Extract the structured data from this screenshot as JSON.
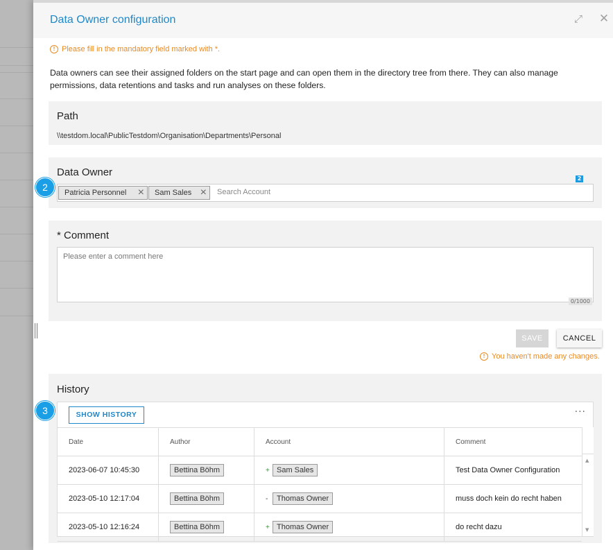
{
  "panel": {
    "title": "Data Owner configuration",
    "mandatory_notice": "Please fill in the mandatory field marked with *.",
    "intro": "Data owners can see their assigned folders on the start page and can open them in the directory tree from there. They can also manage permissions, data retentions and tasks and run analyses on these folders."
  },
  "path": {
    "label": "Path",
    "value": "\\\\testdom.local\\PublicTestdom\\Organisation\\Departments\\Personal"
  },
  "data_owner": {
    "label": "Data Owner",
    "chips": [
      "Patricia Personnel",
      "Sam Sales"
    ],
    "search_placeholder": "Search Account",
    "count": "2",
    "step_badge": "2"
  },
  "comment": {
    "label": "* Comment",
    "placeholder": "Please enter a comment here",
    "char_count": "0/1000"
  },
  "actions": {
    "save_label": "SAVE",
    "cancel_label": "CANCEL",
    "no_changes_notice": "You haven't made any changes."
  },
  "history": {
    "label": "History",
    "step_badge": "3",
    "show_history_label": "SHOW HISTORY",
    "more_icon": "more-horizontal-icon",
    "columns": [
      "Date",
      "Author",
      "Account",
      "Comment"
    ],
    "rows": [
      {
        "date": "2023-06-07 10:45:30",
        "author": "Bettina Böhm",
        "sign": "+",
        "account": "Sam Sales",
        "comment": "Test Data Owner Configuration"
      },
      {
        "date": "2023-05-10 12:17:04",
        "author": "Bettina Böhm",
        "sign": "-",
        "account": "Thomas Owner",
        "comment": "muss doch kein do recht haben"
      },
      {
        "date": "2023-05-10 12:16:24",
        "author": "Bettina Böhm",
        "sign": "+",
        "account": "Thomas Owner",
        "comment": "do recht dazu"
      }
    ]
  },
  "colors": {
    "accent": "#1e88c9",
    "warning": "#e88a21",
    "badge": "#1a9ee6"
  }
}
